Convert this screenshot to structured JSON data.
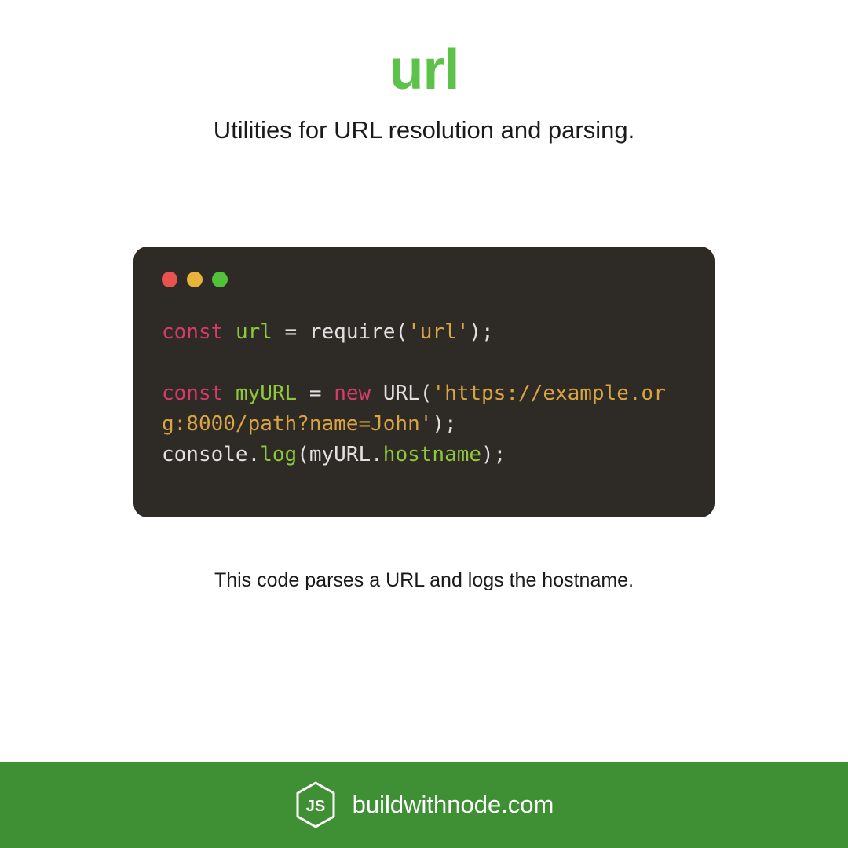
{
  "header": {
    "title": "url",
    "subtitle": "Utilities for URL resolution and parsing."
  },
  "code": {
    "tokens": [
      {
        "t": "const",
        "c": "kw"
      },
      {
        "t": " ",
        "c": "op"
      },
      {
        "t": "url",
        "c": "var"
      },
      {
        "t": " = ",
        "c": "op"
      },
      {
        "t": "require",
        "c": "fn"
      },
      {
        "t": "(",
        "c": "op"
      },
      {
        "t": "'url'",
        "c": "str"
      },
      {
        "t": ");",
        "c": "op"
      },
      {
        "t": "\n\n",
        "c": "op"
      },
      {
        "t": "const",
        "c": "kw"
      },
      {
        "t": " ",
        "c": "op"
      },
      {
        "t": "myURL",
        "c": "var"
      },
      {
        "t": " = ",
        "c": "op"
      },
      {
        "t": "new",
        "c": "new"
      },
      {
        "t": " ",
        "c": "op"
      },
      {
        "t": "URL",
        "c": "fn"
      },
      {
        "t": "(",
        "c": "op"
      },
      {
        "t": "'https://example.org:8000/path?name=John'",
        "c": "str"
      },
      {
        "t": ");",
        "c": "op"
      },
      {
        "t": "\n",
        "c": "op"
      },
      {
        "t": "console",
        "c": "fn"
      },
      {
        "t": ".",
        "c": "op"
      },
      {
        "t": "log",
        "c": "method"
      },
      {
        "t": "(",
        "c": "op"
      },
      {
        "t": "myURL",
        "c": "fn"
      },
      {
        "t": ".",
        "c": "op"
      },
      {
        "t": "hostname",
        "c": "prop"
      },
      {
        "t": ");",
        "c": "op"
      }
    ]
  },
  "caption": "This code parses a URL and logs the hostname.",
  "footer": {
    "site": "buildwithnode.com"
  }
}
